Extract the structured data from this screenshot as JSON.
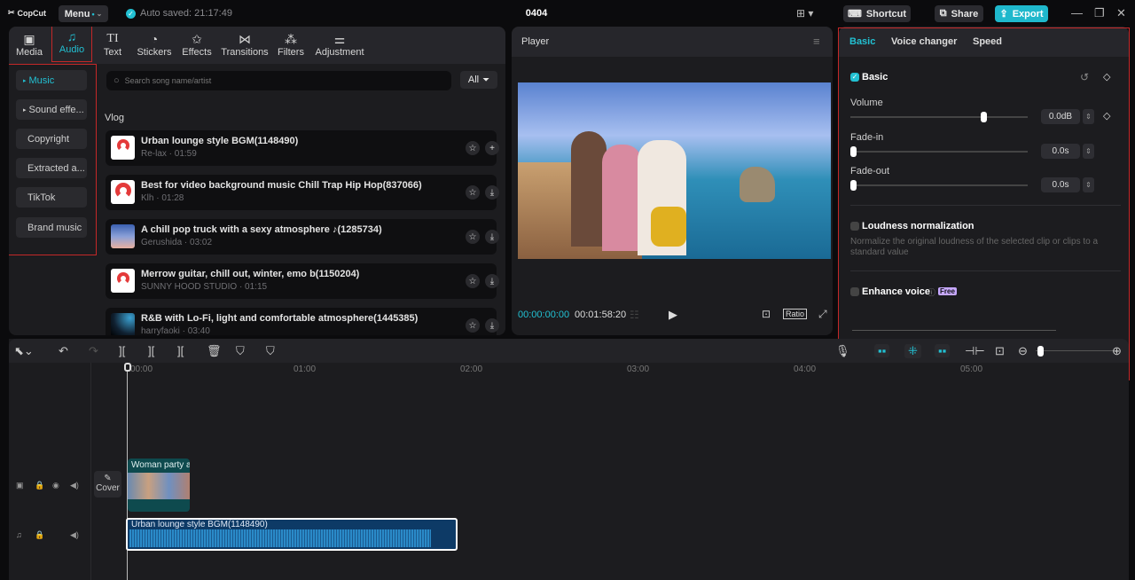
{
  "app": {
    "name": "CopCut",
    "menu_label": "Menu",
    "autosave": "Auto saved: 21:17:49",
    "project_title": "0404"
  },
  "toolbar": {
    "shortcut_label": "Shortcut",
    "share_label": "Share",
    "export_label": "Export"
  },
  "media_tabs": [
    {
      "label": "Media",
      "icon": "media-icon"
    },
    {
      "label": "Audio",
      "icon": "audio-icon",
      "active": true
    },
    {
      "label": "Text",
      "icon": "text-icon"
    },
    {
      "label": "Stickers",
      "icon": "stickers-icon"
    },
    {
      "label": "Effects",
      "icon": "effects-icon"
    },
    {
      "label": "Transitions",
      "icon": "transitions-icon"
    },
    {
      "label": "Filters",
      "icon": "filters-icon"
    },
    {
      "label": "Adjustment",
      "icon": "adjustment-icon"
    }
  ],
  "categories": [
    {
      "label": "Music",
      "active": true,
      "arrow": true
    },
    {
      "label": "Sound effe...",
      "arrow": true
    },
    {
      "label": "Copyright"
    },
    {
      "label": "Extracted a..."
    },
    {
      "label": "TikTok"
    },
    {
      "label": "Brand music"
    }
  ],
  "search": {
    "placeholder": "Search song name/artist",
    "filter_label": "All"
  },
  "section_label": "Vlog",
  "songs": [
    {
      "title": "Urban lounge style BGM(1148490)",
      "meta": "Re-lax · 01:59",
      "action": "add"
    },
    {
      "title": "Best for video background music Chill Trap Hip Hop(837066)",
      "meta": "Klh · 01:28",
      "action": "download"
    },
    {
      "title": "A chill pop truck with a sexy atmosphere ♪(1285734)",
      "meta": "Gerushida · 03:02",
      "action": "download"
    },
    {
      "title": "Merrow guitar, chill out, winter, emo b(1150204)",
      "meta": "SUNNY HOOD STUDIO · 01:15",
      "action": "download"
    },
    {
      "title": "R&B with Lo-Fi, light and comfortable atmosphere(1445385)",
      "meta": "harryfaoki · 03:40",
      "action": "download"
    }
  ],
  "player": {
    "title": "Player",
    "current_time": "00:00:00:00",
    "total_time": "00:01:58:20",
    "ratio_label": "Ratio"
  },
  "inspector": {
    "tabs": [
      {
        "label": "Basic",
        "active": true
      },
      {
        "label": "Voice changer"
      },
      {
        "label": "Speed"
      }
    ],
    "basic_label": "Basic",
    "volume": {
      "label": "Volume",
      "value": "0.0dB",
      "position": 0.75
    },
    "fade_in": {
      "label": "Fade-in",
      "value": "0.0s",
      "position": 0
    },
    "fade_out": {
      "label": "Fade-out",
      "value": "0.0s",
      "position": 0
    },
    "loudness": {
      "label": "Loudness normalization",
      "desc": "Normalize the original loudness of the selected clip or clips to a standard value"
    },
    "enhance": {
      "label": "Enhance voice",
      "badge": "Free"
    }
  },
  "timeline": {
    "ruler": [
      "00:00",
      "01:00",
      "02:00",
      "03:00",
      "04:00",
      "05:00"
    ],
    "cover_label": "Cover",
    "video_clip": "Woman party a",
    "audio_clip": "Urban lounge style BGM(1148490)"
  }
}
